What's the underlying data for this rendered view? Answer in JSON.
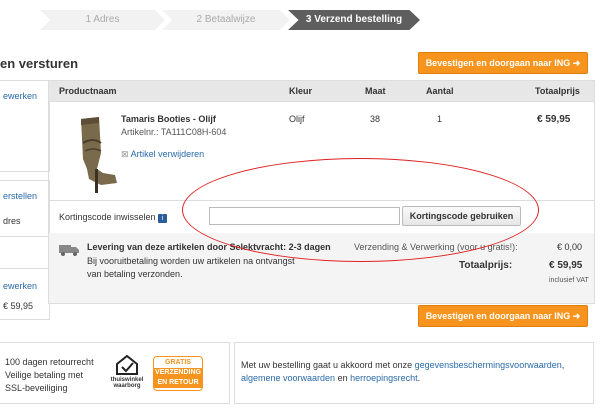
{
  "steps": [
    "1 Adres",
    "2 Betaalwijze",
    "3 Verzend bestelling"
  ],
  "page_title": "en versturen",
  "confirm_button": "Bevestigen en doorgaan naar ING",
  "left_panels": {
    "p1_link": "ewerken",
    "p2_link": "erstellen",
    "p2_text": "dres",
    "p3_link": "ewerken",
    "p3_value": "€ 59,95"
  },
  "table": {
    "headers": {
      "product": "Productnaam",
      "color": "Kleur",
      "size": "Maat",
      "qty": "Aantal",
      "total": "Totaalprijs"
    },
    "row": {
      "name": "Tamaris Booties - Olijf",
      "article": "Artikelnr.: TA111C08H-604",
      "remove": "Artikel verwijderen",
      "color": "Olijf",
      "size": "38",
      "qty": "1",
      "total": "€ 59,95"
    }
  },
  "promo": {
    "label": "Kortingscode inwisselen",
    "input_value": "",
    "button": "Kortingscode gebruiken"
  },
  "shipping": {
    "title": "Levering van deze artikelen door Selektvracht: 2-3 dagen",
    "note": "Bij vooruitbetaling worden uw artikelen na ontvangst van betaling verzonden.",
    "shipping_label": "Verzending & Verwerking (voor u gratis!):",
    "shipping_value": "€ 0,00",
    "total_label": "Totaalprijs:",
    "total_value": "€ 59,95",
    "vat": "inclusief VAT"
  },
  "footer": {
    "usp1": "100 dagen retourrecht",
    "usp2": "Veilige betaling met",
    "usp3": "SSL-beveiliging",
    "thuiswinkel1": "thuiswinkel",
    "thuiswinkel2": "waarborg",
    "badge1": "GRATIS",
    "badge2": "VERZENDING",
    "badge3": "EN RETOUR",
    "terms_pre": "Met uw bestelling gaat u akkoord met onze",
    "terms_link1": "gegevensbeschermingsvoorwaarden",
    "terms_link2": "algemene voorwaarden",
    "terms_mid": "en",
    "terms_link3": "herroepingsrecht"
  }
}
